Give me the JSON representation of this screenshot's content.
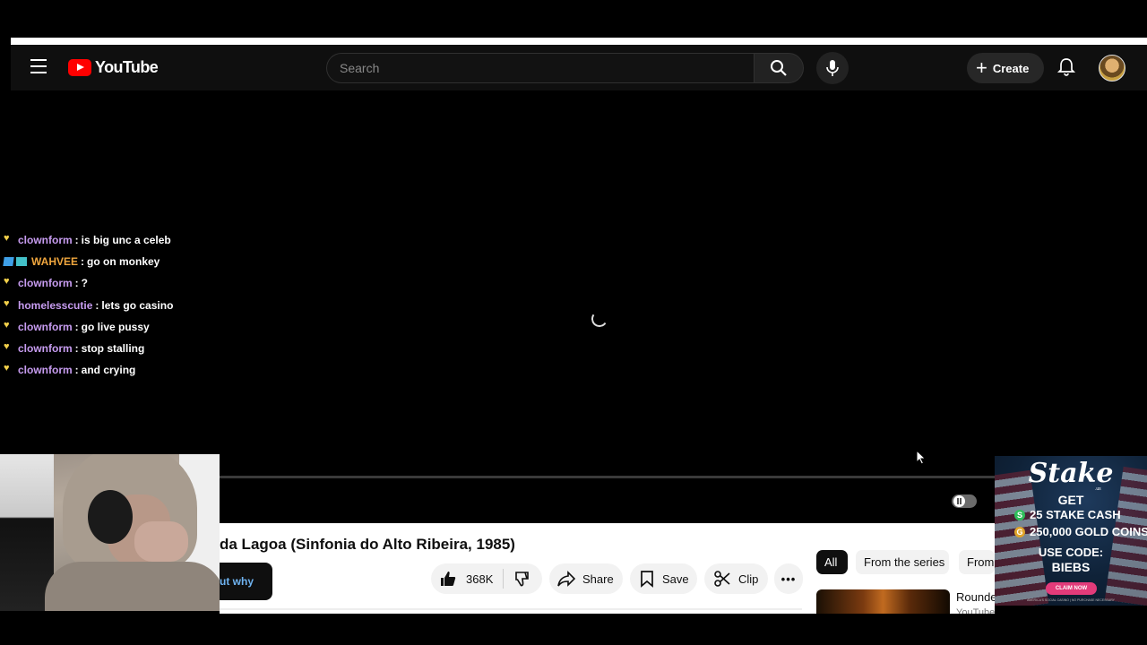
{
  "header": {
    "logo_text": "YouTube",
    "search_placeholder": "Search",
    "create_label": "Create",
    "icons": [
      "menu-icon",
      "youtube-logo-icon",
      "search-icon",
      "mic-icon",
      "plus-icon",
      "bell-icon",
      "avatar"
    ]
  },
  "chat": {
    "messages": [
      {
        "user": "clownform",
        "text": "is big unc a celeb",
        "color": "#c79cf0",
        "badge": "heart"
      },
      {
        "user": "WAHVEE",
        "text": "go on monkey",
        "color": "#f0a63e",
        "badge": "double"
      },
      {
        "user": "clownform",
        "text": "?",
        "color": "#c79cf0",
        "badge": "heart"
      },
      {
        "user": "homelesscutie",
        "text": "lets go casino",
        "color": "#c79cf0",
        "badge": "heart"
      },
      {
        "user": "clownform",
        "text": "go live pussy",
        "color": "#c79cf0",
        "badge": "heart"
      },
      {
        "user": "clownform",
        "text": "stop stalling",
        "color": "#c79cf0",
        "badge": "heart"
      },
      {
        "user": "clownform",
        "text": "and crying",
        "color": "#c79cf0",
        "badge": "heart"
      }
    ],
    "separator": ":"
  },
  "video": {
    "title": "da Lagoa (Sinfonia do Alto Ribeira, 1985)",
    "why_label": "ut why",
    "like_count": "368K",
    "share_label": "Share",
    "save_label": "Save",
    "clip_label": "Clip",
    "more_label": "•••"
  },
  "sidebar": {
    "chips": [
      "All",
      "From the series",
      "From"
    ],
    "recommendation": {
      "title": "Rounde",
      "channel": "YouTube Movies & TV"
    }
  },
  "ad": {
    "logo": "Stake",
    "logo_sub": ".us",
    "get": "GET",
    "line1": "25 STAKE CASH",
    "line2": "250,000 GOLD COINS",
    "use_code": "USE CODE:",
    "code": "BIEBS",
    "claim": "CLAIM NOW",
    "fine_print": "AMERICA'S SOCIAL CASINO | NO PURCHASE NECESSARY",
    "coin1": "S",
    "coin2": "G",
    "coin1_color": "#2fbf5a",
    "coin2_color": "#e0a42a"
  },
  "colors": {
    "accent": "#ff0000",
    "chat_name": "#c79cf0",
    "chat_name_alt": "#f0a63e"
  }
}
